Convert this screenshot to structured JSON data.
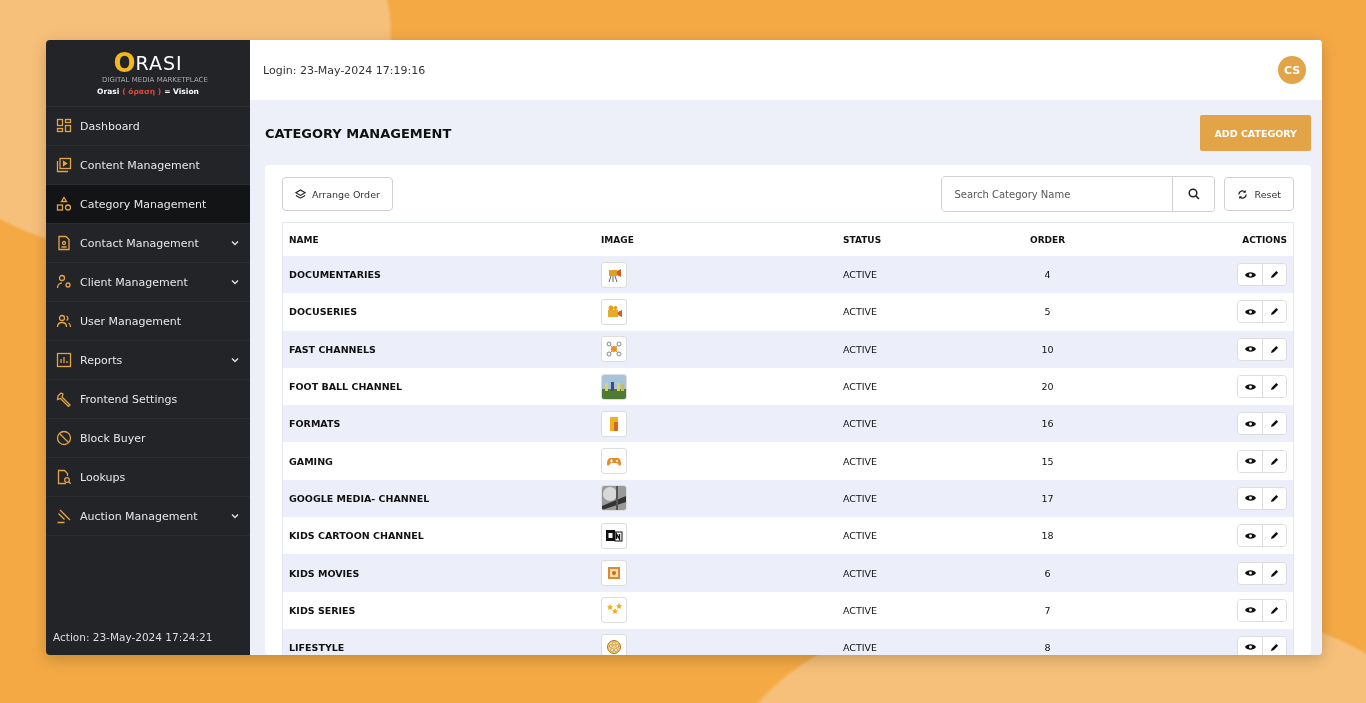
{
  "logo": {
    "mark": "O",
    "name": "RASI",
    "tagline": "DIGITAL MEDIA MARKETPLACE",
    "motto": [
      {
        "text": "Orasi",
        "color": "#ffffff"
      },
      {
        "text": "( όραση )",
        "color": "#e0483c"
      },
      {
        "text": "= Vision",
        "color": "#ffffff"
      }
    ]
  },
  "sidebar": {
    "items": [
      {
        "label": "Dashboard",
        "selected": false,
        "expandable": false
      },
      {
        "label": "Content Management",
        "selected": false,
        "expandable": false
      },
      {
        "label": "Category Management",
        "selected": true,
        "expandable": false
      },
      {
        "label": "Contact Management",
        "selected": false,
        "expandable": true
      },
      {
        "label": "Client Management",
        "selected": false,
        "expandable": true
      },
      {
        "label": "User Management",
        "selected": false,
        "expandable": false
      },
      {
        "label": "Reports",
        "selected": false,
        "expandable": true
      },
      {
        "label": "Frontend Settings",
        "selected": false,
        "expandable": false
      },
      {
        "label": "Block Buyer",
        "selected": false,
        "expandable": false
      },
      {
        "label": "Lookups",
        "selected": false,
        "expandable": false
      },
      {
        "label": "Auction Management",
        "selected": false,
        "expandable": true
      }
    ],
    "footer": "Action: 23-May-2024 17:24:21"
  },
  "header": {
    "login": "Login: 23-May-2024 17:19:16",
    "avatar": "CS"
  },
  "page": {
    "title": "CATEGORY MANAGEMENT",
    "add_button": "ADD CATEGORY"
  },
  "toolbar": {
    "arrange_button": "Arrange Order",
    "search": {
      "placeholder": "Search Category Name"
    },
    "reset_button": "Reset"
  },
  "table": {
    "columns": [
      "NAME",
      "IMAGE",
      "STATUS",
      "ORDER",
      "ACTIONS"
    ],
    "rows": [
      {
        "name": "DOCUMENTARIES",
        "status": "ACTIVE",
        "order": "4"
      },
      {
        "name": "DOCUSERIES",
        "status": "ACTIVE",
        "order": "5"
      },
      {
        "name": "FAST CHANNELS",
        "status": "ACTIVE",
        "order": "10"
      },
      {
        "name": "FOOT BALL CHANNEL",
        "status": "ACTIVE",
        "order": "20"
      },
      {
        "name": "FORMATS",
        "status": "ACTIVE",
        "order": "16"
      },
      {
        "name": "GAMING",
        "status": "ACTIVE",
        "order": "15"
      },
      {
        "name": "GOOGLE MEDIA- CHANNEL",
        "status": "ACTIVE",
        "order": "17"
      },
      {
        "name": "KIDS CARTOON CHANNEL",
        "status": "ACTIVE",
        "order": "18"
      },
      {
        "name": "KIDS MOVIES",
        "status": "ACTIVE",
        "order": "6"
      },
      {
        "name": "KIDS SERIES",
        "status": "ACTIVE",
        "order": "7"
      },
      {
        "name": "LIFESTYLE",
        "status": "ACTIVE",
        "order": "8"
      }
    ]
  }
}
